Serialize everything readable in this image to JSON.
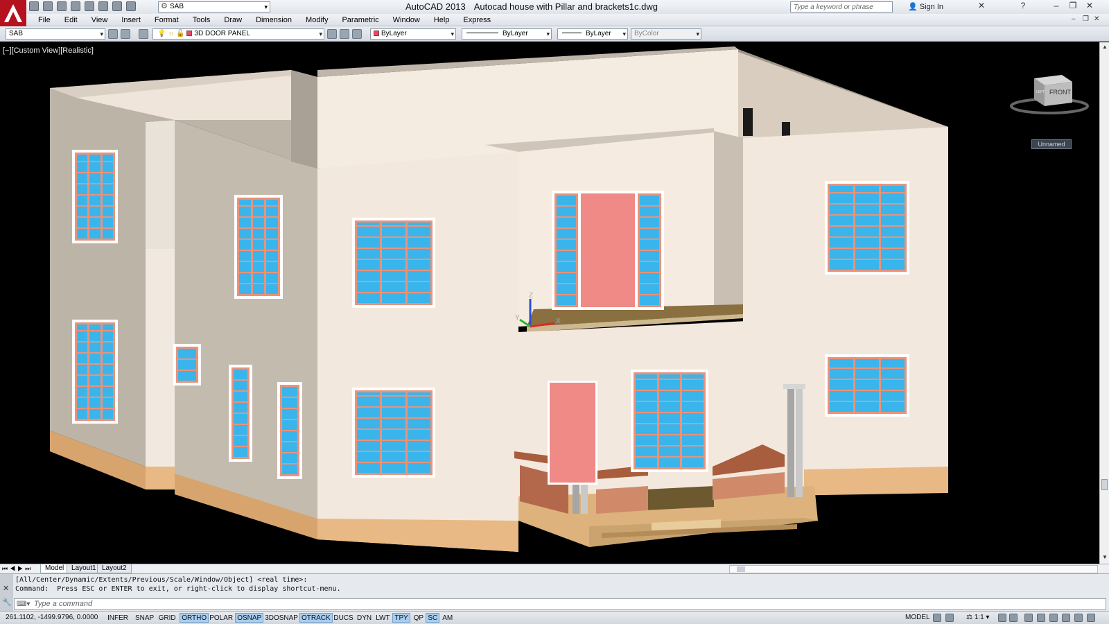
{
  "app": {
    "name": "AutoCAD 2013",
    "document": "Autocad house with Pillar and brackets1c.dwg",
    "workspace": "SAB",
    "search_placeholder": "Type a keyword or phrase",
    "sign_in": "Sign In",
    "accent": "#c8102e"
  },
  "menu": [
    "File",
    "Edit",
    "View",
    "Insert",
    "Format",
    "Tools",
    "Draw",
    "Dimension",
    "Modify",
    "Parametric",
    "Window",
    "Help",
    "Express"
  ],
  "toolbar": {
    "layer_state": "SAB",
    "layer": "3D DOOR PANEL",
    "color": "ByLayer",
    "linetype": "ByLayer",
    "lineweight": "ByLayer",
    "plotstyle": "ByColor"
  },
  "viewport": {
    "label": "[−][Custom View][Realistic]",
    "viewcube_face": "FRONT",
    "viewcube_side": "LEFT",
    "ucs_name": "Unnamed",
    "axis_z": "Z",
    "axis_y": "Y",
    "axis_x": "X",
    "wall_color": "#f2e8de",
    "glass_color": "#3ab5ec",
    "frame_color": "#e9937a",
    "base_color": "#e8b985"
  },
  "layout_tabs": [
    "Model",
    "Layout1",
    "Layout2"
  ],
  "command": {
    "history": [
      "[All/Center/Dynamic/Extents/Previous/Scale/Window/Object] <real time>:",
      "Command:  Press ESC or ENTER to exit, or right-click to display shortcut-menu."
    ],
    "placeholder": "Type a command"
  },
  "status": {
    "coords": "261.1102, -1499.9796, 0.0000",
    "toggles": [
      {
        "label": "INFER",
        "on": false
      },
      {
        "label": "SNAP",
        "on": false
      },
      {
        "label": "GRID",
        "on": false
      },
      {
        "label": "ORTHO",
        "on": true
      },
      {
        "label": "POLAR",
        "on": false
      },
      {
        "label": "OSNAP",
        "on": true
      },
      {
        "label": "3DOSNAP",
        "on": false
      },
      {
        "label": "OTRACK",
        "on": true
      },
      {
        "label": "DUCS",
        "on": false
      },
      {
        "label": "DYN",
        "on": false
      },
      {
        "label": "LWT",
        "on": false
      },
      {
        "label": "TPY",
        "on": true
      },
      {
        "label": "QP",
        "on": false
      },
      {
        "label": "SC",
        "on": true
      },
      {
        "label": "AM",
        "on": false
      }
    ],
    "space": "MODEL",
    "scale": "1:1"
  }
}
